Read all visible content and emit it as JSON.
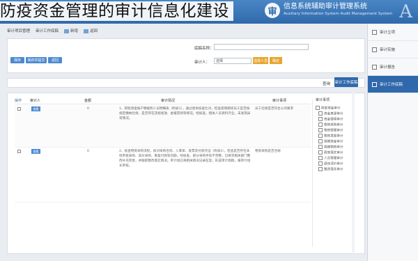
{
  "caption": "防疫资金管理的审计信息化建设",
  "header": {
    "logo_symbol": "审",
    "title": "信息系统辅助审计管理系统",
    "subtitle": "Auxiliary Information System Audit Management System",
    "mark": "A"
  },
  "sidebar": {
    "items": [
      {
        "label": "审计立项",
        "icon": "folder-icon"
      },
      {
        "label": "审计实施",
        "icon": "clipboard-icon"
      },
      {
        "label": "审计报告",
        "icon": "report-icon"
      },
      {
        "label": "审计工作底稿",
        "icon": "document-icon",
        "active": true
      }
    ]
  },
  "toolbar": {
    "items": [
      "审计项目管理",
      "审计工作底稿",
      "新增",
      "返回"
    ]
  },
  "form": {
    "buttons": [
      "保存",
      "保存并提交",
      "返回"
    ],
    "name_label": "底稿名称：",
    "auditor_label": "审计人：",
    "select_label": "选择",
    "orange_btn1": "选择人员",
    "orange_btn2": "确定",
    "search_label": "查询"
  },
  "mid": {
    "tab_label": "审计工作底稿"
  },
  "table": {
    "headers": [
      "审计事项",
      "审计情况",
      "金额",
      "审计人",
      "操作"
    ],
    "rows": [
      {
        "item": "员工社保是否符合公司要求",
        "detail": "1、获取资金账户数据和人员明细表（附表1），通过逐条核查比对，检查疫情期间员工是否按规定缴纳社保，是否存在违规发放、虚报冒领等情况。经核查，相关人员资料齐全，未发现异常情况。",
        "amount": "0",
        "auditor": "查看"
      },
      {
        "item": "物资采购是否合规",
        "detail": "2、核查物资采购流程，核对采购合同、入库单、发票及付款凭证（附表2），检查是否存在未经审批采购、高价采购、重复付款等问题。经核查，部分采购手续不完整，已要求相关部门整改补充完善，并跟踪整改落实情况。审计组已将相关情况记录在案，形成审计底稿，报审计组长审核。",
        "amount": "0",
        "auditor": "查看"
      }
    ]
  },
  "tree": {
    "title": "审计事项",
    "items": [
      "防疫资金审计",
      "资金来源审计",
      "资金使用审计",
      "物资采购审计",
      "物资管理审计",
      "物资发放审计",
      "捐赠资金审计",
      "捐赠物资审计",
      "政策落实审计",
      "人员管理审计",
      "绩效评价审计",
      "整改落实审计"
    ]
  }
}
